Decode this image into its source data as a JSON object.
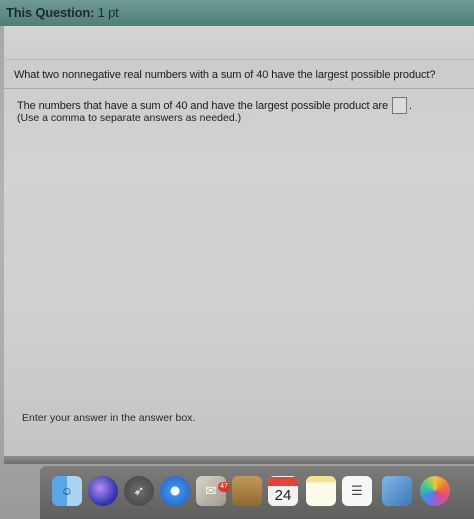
{
  "header": {
    "title": "This Question:",
    "points": "1 pt"
  },
  "question": {
    "text": "What two nonnegative real numbers with a sum of 40 have the largest possible product?"
  },
  "answer": {
    "prompt": "The numbers that have a sum of 40 and have the largest possible product are",
    "period": ".",
    "instruction": "(Use a comma to separate answers as needed.)"
  },
  "hint": "Enter your answer in the answer box.",
  "dock": {
    "items": [
      {
        "name": "finder",
        "icon": "finder-icon"
      },
      {
        "name": "siri",
        "icon": "siri-icon"
      },
      {
        "name": "launchpad",
        "icon": "rocket-icon"
      },
      {
        "name": "safari",
        "icon": "compass-icon"
      },
      {
        "name": "mail",
        "icon": "mail-icon"
      },
      {
        "name": "notes-folder",
        "icon": "folder-icon"
      },
      {
        "name": "calendar",
        "icon": "calendar-icon"
      },
      {
        "name": "notes",
        "icon": "notes-icon"
      },
      {
        "name": "reminders",
        "icon": "reminders-icon"
      },
      {
        "name": "preview",
        "icon": "preview-icon"
      },
      {
        "name": "photos",
        "icon": "photos-icon"
      }
    ],
    "badge_count": "47",
    "calendar_day": "24"
  }
}
